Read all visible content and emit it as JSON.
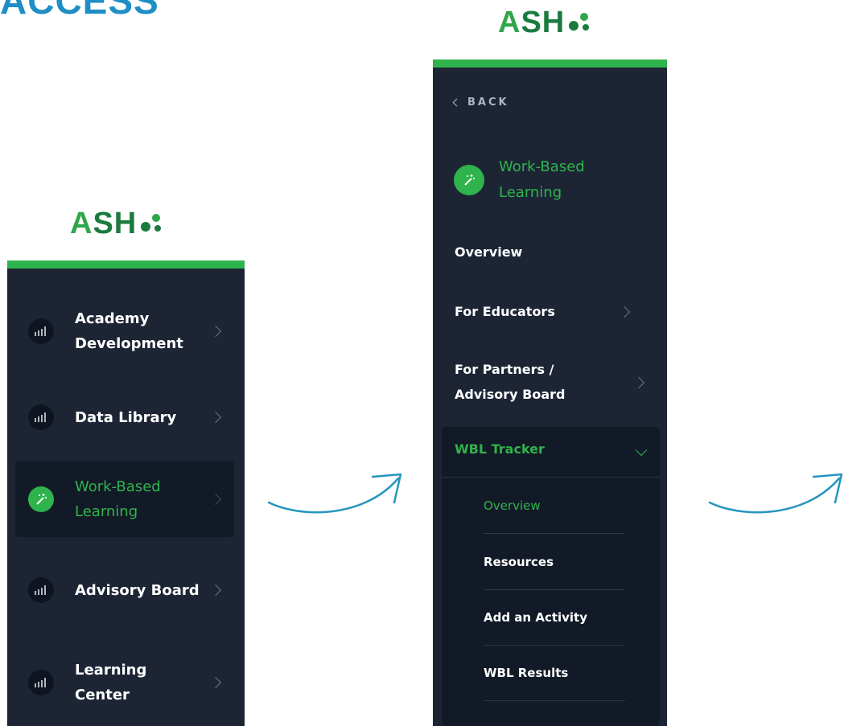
{
  "heading": "ACCESS",
  "logo": {
    "text": "ASH",
    "color": "#1b7b3f"
  },
  "colors": {
    "accent": "#2fb34c",
    "panel_bg": "#1d2535",
    "active_bg": "#131a27",
    "heading": "#1f8ec4",
    "arrow": "#2596be"
  },
  "panel1": {
    "items": [
      {
        "label": "Academy Development",
        "icon": "bar-chart-icon"
      },
      {
        "label": "Data Library",
        "icon": "bar-chart-icon"
      },
      {
        "label": "Work-Based Learning",
        "icon": "magic-wand-icon",
        "active": true
      },
      {
        "label": "Advisory Board",
        "icon": "bar-chart-icon"
      },
      {
        "label": "Learning Center",
        "icon": "bar-chart-icon"
      }
    ]
  },
  "panel2": {
    "back_label": "BACK",
    "section_title": "Work-Based Learning",
    "section_icon": "magic-wand-icon",
    "nav": [
      {
        "label": "Overview"
      },
      {
        "label": "For Educators"
      },
      {
        "label": "For Partners / Advisory Board"
      }
    ],
    "tracker": {
      "label": "WBL Tracker",
      "expanded": true,
      "items": [
        {
          "label": "Overview",
          "active": true
        },
        {
          "label": "Resources"
        },
        {
          "label": "Add an Activity"
        },
        {
          "label": "WBL Results"
        }
      ]
    }
  }
}
